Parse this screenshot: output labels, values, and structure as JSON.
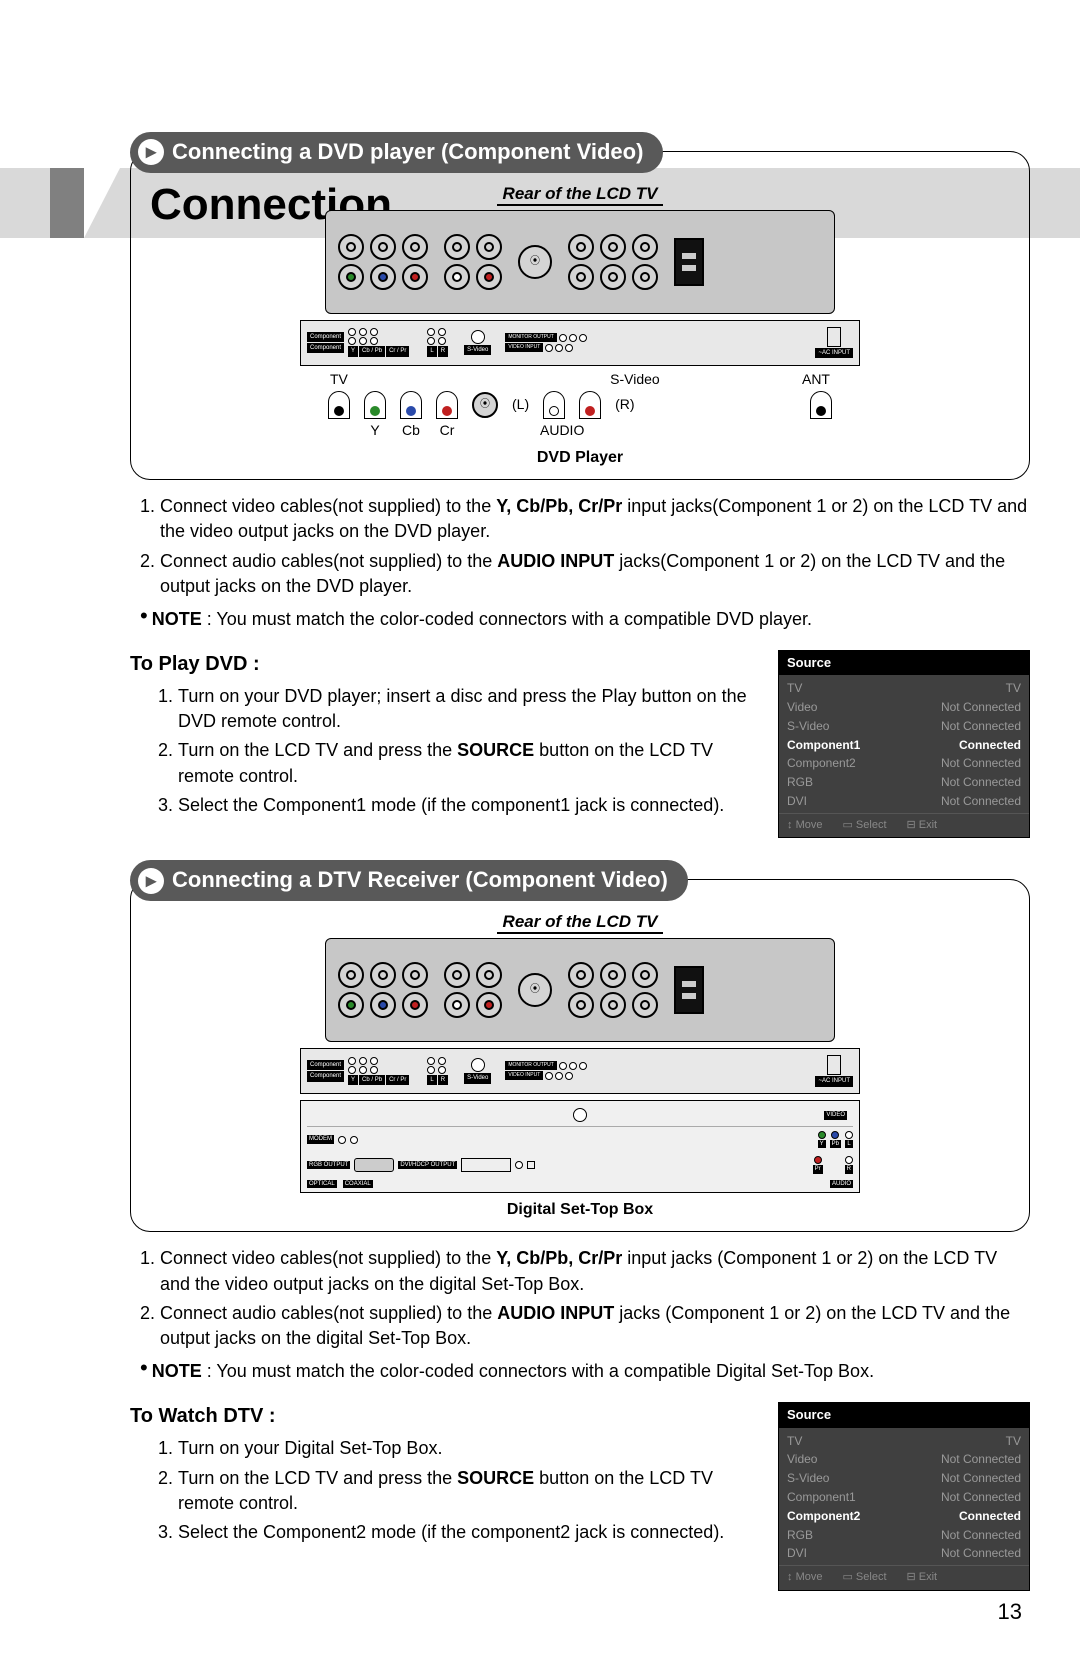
{
  "page_title": "Connection",
  "page_number": "13",
  "section1": {
    "heading": "Connecting a DVD player (Component Video)",
    "top_caption": "Rear of the LCD TV",
    "bottom_caption": "DVD Player",
    "panel_labels": {
      "component": "Component",
      "y": "Y",
      "cbpb": "Cb / Pb",
      "crpr": "Cr / Pr",
      "l": "L",
      "r": "R",
      "svideo": "S-Video",
      "monitor": "MONITOR OUTPUT",
      "video_input": "VIDEO INPUT",
      "ac": "~AC INPUT"
    },
    "plug_row_top": {
      "tv": "TV",
      "svideo": "S-Video",
      "ant": "ANT"
    },
    "plug_row_mid": {
      "l": "(L)",
      "r": "(R)"
    },
    "plug_row_bot": {
      "y": "Y",
      "cb": "Cb",
      "cr": "Cr",
      "audio": "AUDIO"
    },
    "steps": [
      {
        "pre": "Connect video cables(not supplied) to the ",
        "bold": "Y, Cb/Pb, Cr/Pr",
        "post": " input jacks(Component 1 or 2) on the LCD TV and the video output jacks on the DVD player."
      },
      {
        "pre": "Connect audio cables(not supplied) to the ",
        "bold": "AUDIO INPUT",
        "post": " jacks(Component 1 or 2) on the LCD TV and the output jacks on the DVD player."
      }
    ],
    "note_bold": "NOTE",
    "note_text": " : You must match the color-coded connectors with a compatible DVD player.",
    "sub_heading": "To Play DVD :",
    "sub_steps": [
      "Turn on your DVD player; insert a disc and press the Play button on the DVD remote control.",
      {
        "pre": "Turn on the LCD TV and press the ",
        "bold": "SOURCE",
        "post": " button on the LCD TV remote control."
      },
      "Select the Component1 mode (if the component1 jack is connected)."
    ],
    "osd": {
      "title": "Source",
      "rows": [
        {
          "label": "TV",
          "status": "TV",
          "hl": false
        },
        {
          "label": "Video",
          "status": "Not Connected",
          "hl": false
        },
        {
          "label": "S-Video",
          "status": "Not Connected",
          "hl": false
        },
        {
          "label": "Component1",
          "status": "Connected",
          "hl": true
        },
        {
          "label": "Component2",
          "status": "Not Connected",
          "hl": false
        },
        {
          "label": "RGB",
          "status": "Not Connected",
          "hl": false
        },
        {
          "label": "DVI",
          "status": "Not Connected",
          "hl": false
        }
      ],
      "foot": {
        "move": "Move",
        "select": "Select",
        "exit": "Exit"
      }
    }
  },
  "section2": {
    "heading": "Connecting a DTV Receiver (Component Video)",
    "top_caption": "Rear of the LCD TV",
    "bottom_caption": "Digital Set-Top Box",
    "stb_labels": {
      "modem": "MODEM",
      "video": "VIDEO",
      "rgb_out": "RGB OUTPUT",
      "dvi_out": "DVI/HDCP OUTPUT",
      "y": "Y",
      "pb": "Pb",
      "pr": "Pr",
      "l": "L",
      "r": "R",
      "audio": "AUDIO",
      "optical": "OPTICAL",
      "coaxial": "COAXIAL"
    },
    "steps": [
      {
        "pre": "Connect video cables(not supplied) to the ",
        "bold": "Y, Cb/Pb, Cr/Pr",
        "post": " input jacks (Component 1 or 2) on the LCD TV and the video output jacks on the digital Set-Top Box."
      },
      {
        "pre": "Connect audio cables(not supplied) to the ",
        "bold": "AUDIO INPUT",
        "post": " jacks (Component 1 or 2) on the LCD TV and the output jacks on the digital Set-Top Box."
      }
    ],
    "note_bold": "NOTE",
    "note_text": " : You must match the color-coded connectors with a compatible Digital Set-Top Box.",
    "sub_heading": "To Watch DTV :",
    "sub_steps": [
      "Turn on your Digital Set-Top Box.",
      {
        "pre": "Turn on the LCD TV and press the ",
        "bold": "SOURCE",
        "post": " button on the LCD TV remote control."
      },
      "Select the Component2 mode (if the component2 jack is connected)."
    ],
    "osd": {
      "title": "Source",
      "rows": [
        {
          "label": "TV",
          "status": "TV",
          "hl": false
        },
        {
          "label": "Video",
          "status": "Not Connected",
          "hl": false
        },
        {
          "label": "S-Video",
          "status": "Not Connected",
          "hl": false
        },
        {
          "label": "Component1",
          "status": "Not Connected",
          "hl": false
        },
        {
          "label": "Component2",
          "status": "Connected",
          "hl": true
        },
        {
          "label": "RGB",
          "status": "Not Connected",
          "hl": false
        },
        {
          "label": "DVI",
          "status": "Not Connected",
          "hl": false
        }
      ],
      "foot": {
        "move": "Move",
        "select": "Select",
        "exit": "Exit"
      }
    }
  }
}
